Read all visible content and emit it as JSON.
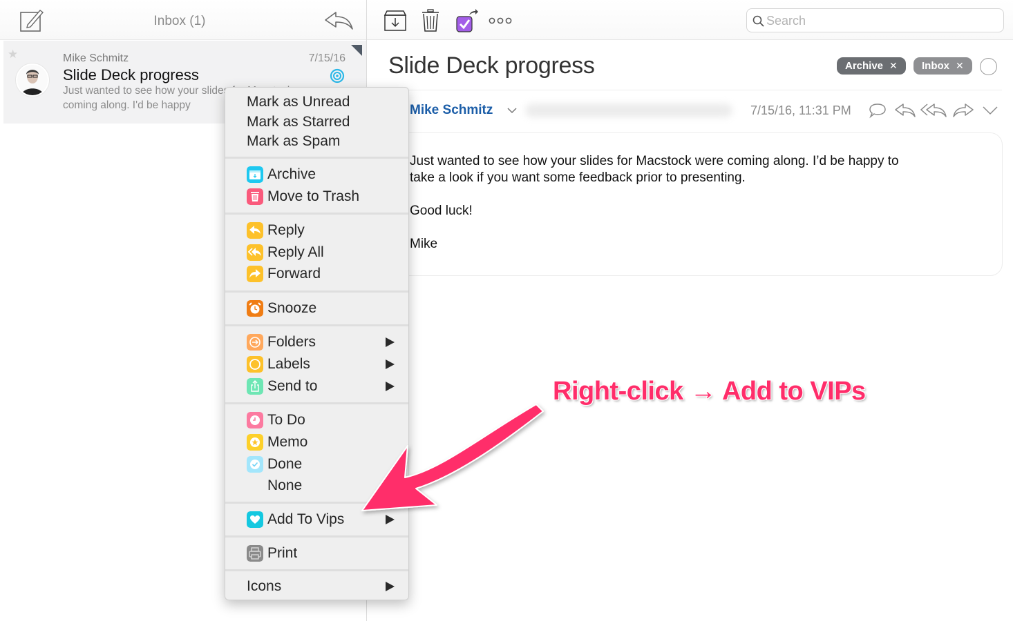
{
  "left_pane": {
    "title": "Inbox (1)",
    "toolbar": {
      "compose_icon": "compose-icon",
      "reply_icon": "reply-icon"
    },
    "mail_item": {
      "sender": "Mike Schmitz",
      "date": "7/15/16",
      "subject": "Slide Deck progress",
      "preview": "Just wanted to see how your slides for Macstock were coming along. I'd be happy",
      "starred": false,
      "status_icon": "target-icon",
      "status_color": "#2bb8e8"
    }
  },
  "right_toolbar": {
    "buttons": [
      {
        "name": "archive-button",
        "icon": "archive-box-icon"
      },
      {
        "name": "trash-button",
        "icon": "trash-icon"
      },
      {
        "name": "todo-move-button",
        "icon": "checkbox-share-icon",
        "color": "#a35ee8"
      },
      {
        "name": "more-button",
        "icon": "more-dots-icon"
      }
    ],
    "search": {
      "placeholder": "Search",
      "value": ""
    }
  },
  "message": {
    "title": "Slide Deck progress",
    "tags": [
      {
        "label": "Archive",
        "color": "#6b6e72"
      },
      {
        "label": "Inbox",
        "color": "#8e8f92"
      }
    ],
    "sender": "Mike Schmitz",
    "datetime": "7/15/16, 11:31 PM",
    "sender_color": "#1c5ea8",
    "body": [
      "Just wanted to see how your slides for Macstock were coming along. I’d be happy to take a look if you want some feedback prior to presenting.",
      "Good luck!",
      "Mike"
    ]
  },
  "context_menu": {
    "groups": [
      [
        {
          "label": "Mark as Unread"
        },
        {
          "label": "Mark as Starred"
        },
        {
          "label": "Mark as Spam"
        }
      ],
      [
        {
          "label": "Archive",
          "icon": "archive-icon",
          "color": "#1ec8f0"
        },
        {
          "label": "Move to Trash",
          "icon": "trash-icon",
          "color": "#fa5a7c"
        }
      ],
      [
        {
          "label": "Reply",
          "icon": "reply-icon",
          "color": "#fdc12a"
        },
        {
          "label": "Reply All",
          "icon": "reply-all-icon",
          "color": "#fdc12a"
        },
        {
          "label": "Forward",
          "icon": "forward-icon",
          "color": "#fdc12a"
        }
      ],
      [
        {
          "label": "Snooze",
          "icon": "alarm-clock-icon",
          "color": "#f07d14"
        }
      ],
      [
        {
          "label": "Folders",
          "icon": "folder-arrow-icon",
          "color": "#ffa85c",
          "submenu": true
        },
        {
          "label": "Labels",
          "icon": "label-circle-icon",
          "color": "#fdc12a",
          "submenu": true
        },
        {
          "label": "Send to",
          "icon": "share-icon",
          "color": "#6ee6b4",
          "submenu": true
        }
      ],
      [
        {
          "label": "To Do",
          "icon": "clock-icon",
          "color": "#fc7aa0"
        },
        {
          "label": "Memo",
          "icon": "star-badge-icon",
          "color": "#fdd02a"
        },
        {
          "label": "Done",
          "icon": "check-circle-icon",
          "color": "#a3e6fc"
        },
        {
          "label": "None"
        }
      ],
      [
        {
          "label": "Add To Vips",
          "icon": "heart-icon",
          "color": "#14c8e0",
          "submenu": true
        }
      ],
      [
        {
          "label": "Print",
          "icon": "printer-icon",
          "color": "#8a8a8a"
        }
      ],
      [
        {
          "label": "Icons",
          "submenu": true
        }
      ]
    ]
  },
  "annotation": {
    "text": "Right-click → Add to VIPs",
    "color": "#ff2d6a"
  }
}
